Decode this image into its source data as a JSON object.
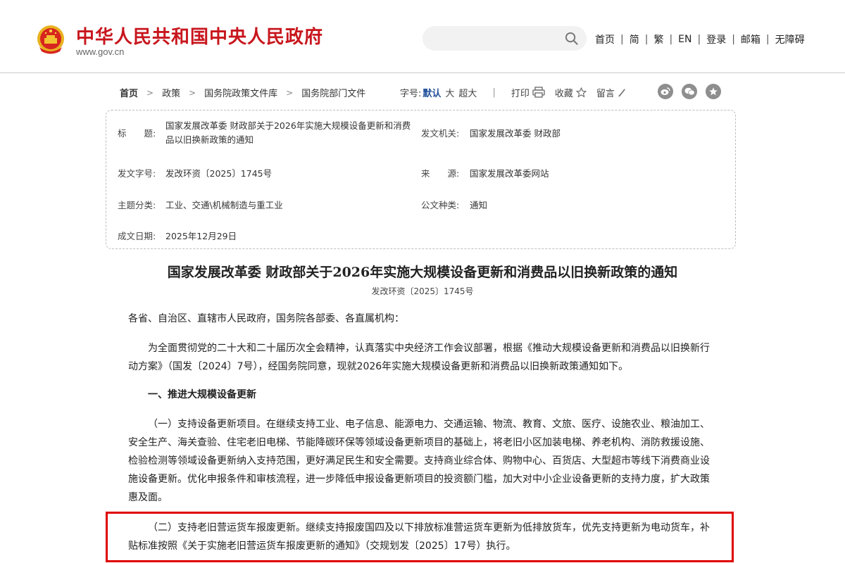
{
  "header": {
    "site_title": "中华人民共和国中央人民政府",
    "site_domain": "www.gov.cn",
    "nav": [
      "首页",
      "简",
      "繁",
      "EN",
      "登录",
      "邮箱",
      "无障碍"
    ]
  },
  "breadcrumb": [
    "首页",
    "政策",
    "国务院政策文件库",
    "国务院部门文件"
  ],
  "toolbar": {
    "font_size_label": "字号:",
    "font_sizes": [
      "默认",
      "大",
      "超大"
    ],
    "print_label": "打印",
    "favorite_label": "收藏",
    "comment_label": "留言",
    "share": [
      "weibo-icon",
      "wechat-icon",
      "qzone-icon"
    ]
  },
  "meta": {
    "title_label": "标　　题:",
    "title_value": "国家发展改革委 财政部关于2026年实施大规模设备更新和消费品以旧换新政策的通知",
    "issuer_label": "发文机关:",
    "issuer_value": "国家发展改革委 财政部",
    "docno_label": "发文字号:",
    "docno_value": "发改环资〔2025〕1745号",
    "source_label": "来　　源:",
    "source_value": "国家发展改革委网站",
    "category_label": "主题分类:",
    "category_value": "工业、交通\\机械制造与重工业",
    "doctype_label": "公文种类:",
    "doctype_value": "通知",
    "date_label": "成文日期:",
    "date_value": "2025年12月29日"
  },
  "article": {
    "title": "国家发展改革委 财政部关于2026年实施大规模设备更新和消费品以旧换新政策的通知",
    "docno": "发改环资〔2025〕1745号",
    "addressee": "各省、自治区、直辖市人民政府，国务院各部委、各直属机构：",
    "intro": "为全面贯彻党的二十大和二十届历次全会精神，认真落实中央经济工作会议部署，根据《推动大规模设备更新和消费品以旧换新行动方案》（国发〔2024〕7号），经国务院同意，现就2026年实施大规模设备更新和消费品以旧换新政策通知如下。",
    "section1": "一、推进大规模设备更新",
    "item1": "（一）支持设备更新项目。在继续支持工业、电子信息、能源电力、交通运输、物流、教育、文旅、医疗、设施农业、粮油加工、安全生产、海关查验、住宅老旧电梯、节能降碳环保等领域设备更新项目的基础上，将老旧小区加装电梯、养老机构、消防救援设施、检验检测等领域设备更新纳入支持范围，更好满足民生和安全需要。支持商业综合体、购物中心、百货店、大型超市等线下消费商业设施设备更新。优化申报条件和审核流程，进一步降低申报设备更新项目的投资额门槛，加大对中小企业设备更新的支持力度，扩大政策惠及面。",
    "item2": "（二）支持老旧营运货车报废更新。继续支持报废国四及以下排放标准营运货车更新为低排放货车，优先支持更新为电动货车，补贴标准按照《关于实施老旧营运货车报废更新的通知》（交规划发〔2025〕17号）执行。"
  },
  "colors": {
    "brand_red": "#c8161d",
    "highlight_red": "#e00000",
    "link_blue": "#1f4f9a"
  }
}
